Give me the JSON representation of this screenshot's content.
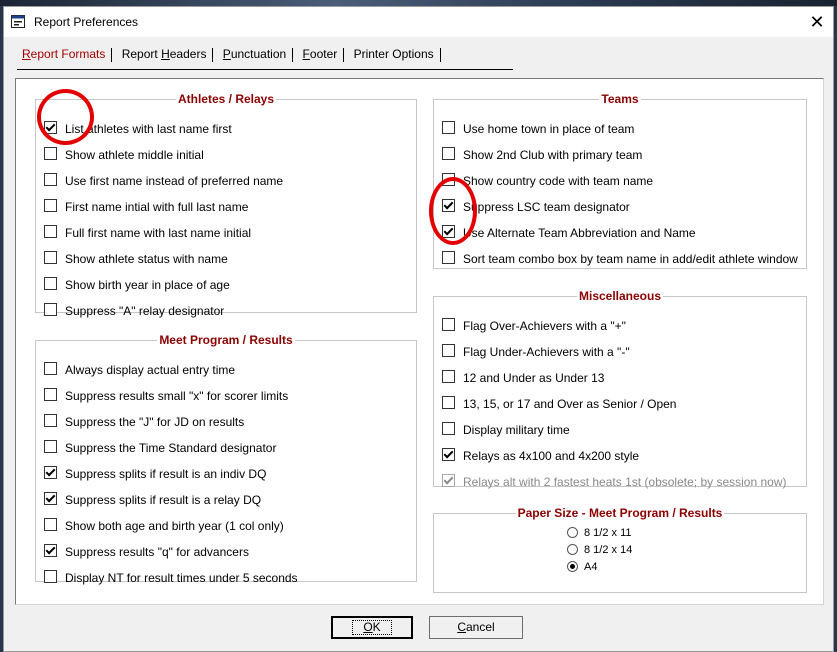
{
  "window": {
    "title": "Report Preferences",
    "close_glyph": "✕"
  },
  "tabs": [
    {
      "label": "Report Formats",
      "accel": "R",
      "rest": "eport Formats",
      "active": true
    },
    {
      "label": "Report Headers",
      "pre": "Report ",
      "accel": "H",
      "rest": "eaders"
    },
    {
      "label": "Punctuation",
      "accel": "P",
      "rest": "unctuation"
    },
    {
      "label": "Footer",
      "accel": "F",
      "rest": "ooter"
    },
    {
      "label": "Printer Options",
      "accel": "",
      "rest": "Printer Options"
    }
  ],
  "athletes": {
    "title": "Athletes / Relays",
    "options": [
      {
        "label": "List athletes with last name first",
        "checked": true
      },
      {
        "label": "Show athlete middle initial",
        "checked": false
      },
      {
        "label": "Use first name instead of preferred name",
        "checked": false
      },
      {
        "label": "First name intial with full last name",
        "checked": false
      },
      {
        "label": "Full first name with last name initial",
        "checked": false
      },
      {
        "label": "Show athlete status with name",
        "checked": false
      },
      {
        "label": "Show birth year in place of age",
        "checked": false
      },
      {
        "label": "Suppress \"A\" relay designator",
        "checked": false
      }
    ]
  },
  "meet_program": {
    "title": "Meet Program / Results",
    "options": [
      {
        "label": "Always display actual entry time",
        "checked": false
      },
      {
        "label": "Suppress results small \"x\" for scorer limits",
        "checked": false
      },
      {
        "label": "Suppress the \"J\" for JD on results",
        "checked": false
      },
      {
        "label": "Suppress the Time Standard designator",
        "checked": false
      },
      {
        "label": "Suppress splits if result is an indiv DQ",
        "checked": true
      },
      {
        "label": "Suppress splits if result is a relay DQ",
        "checked": true
      },
      {
        "label": "Show both age and birth year (1 col only)",
        "checked": false
      },
      {
        "label": "Suppress results \"q\" for advancers",
        "checked": true
      },
      {
        "label": "Display NT for result times under 5 seconds",
        "checked": false
      }
    ]
  },
  "teams": {
    "title": "Teams",
    "options": [
      {
        "label": "Use home town in place of team",
        "checked": false
      },
      {
        "label": "Show 2nd Club with primary team",
        "checked": false
      },
      {
        "label": "Show country code with team name",
        "checked": false
      },
      {
        "label": "Suppress LSC team designator",
        "checked": true
      },
      {
        "label": "Use Alternate Team Abbreviation and Name",
        "checked": true
      },
      {
        "label": "Sort team combo box by team name in add/edit athlete window",
        "checked": false
      }
    ]
  },
  "misc": {
    "title": "Miscellaneous",
    "options": [
      {
        "label": "Flag Over-Achievers with a \"+\"",
        "checked": false
      },
      {
        "label": "Flag Under-Achievers with a \"-\"",
        "checked": false
      },
      {
        "label": "12 and Under as Under 13",
        "checked": false
      },
      {
        "label": "13, 15, or 17 and Over as Senior / Open",
        "checked": false
      },
      {
        "label": "Display military time",
        "checked": false
      },
      {
        "label": "Relays as 4x100 and 4x200 style",
        "checked": true
      },
      {
        "label": "Relays alt with 2 fastest heats 1st (obsolete; by session now)",
        "checked": true,
        "disabled": true
      }
    ]
  },
  "paper": {
    "title": "Paper Size - Meet Program / Results",
    "options": [
      {
        "label": "8 1/2 x 11",
        "selected": false
      },
      {
        "label": "8 1/2 x 14",
        "selected": false
      },
      {
        "label": "A4",
        "selected": true
      }
    ]
  },
  "buttons": {
    "ok": {
      "label": "OK",
      "accel": "O",
      "rest": "K"
    },
    "cancel": {
      "label": "Cancel",
      "accel": "C",
      "rest": "ancel"
    }
  },
  "annotation_color": "#e30000"
}
